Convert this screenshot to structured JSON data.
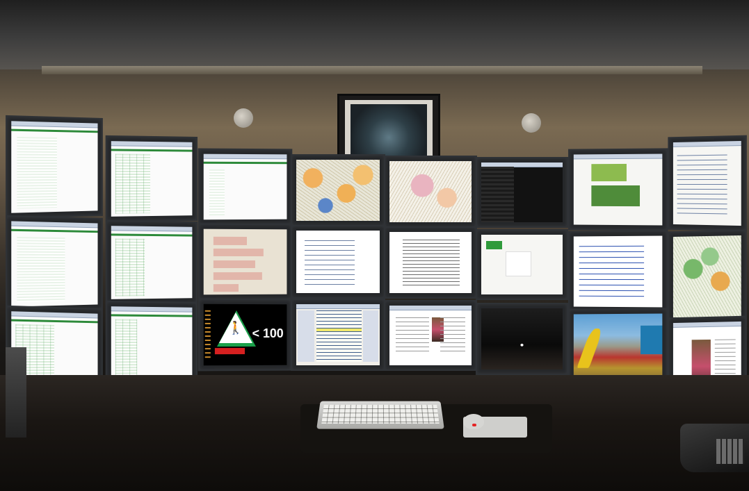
{
  "scene": {
    "description_free": true
  },
  "monitors": [
    {
      "row": 1,
      "col": 1,
      "content": "spreadsheet"
    },
    {
      "row": 1,
      "col": 2,
      "content": "spreadsheet"
    },
    {
      "row": 1,
      "col": 3,
      "content": "spreadsheet"
    },
    {
      "row": 1,
      "col": 4,
      "content": "map"
    },
    {
      "row": 1,
      "col": 5,
      "content": "map"
    },
    {
      "row": 1,
      "col": 6,
      "content": "dark-terminal"
    },
    {
      "row": 1,
      "col": 7,
      "content": "web-page"
    },
    {
      "row": 1,
      "col": 8,
      "content": "web-page"
    },
    {
      "row": 2,
      "col": 1,
      "content": "spreadsheet"
    },
    {
      "row": 2,
      "col": 2,
      "content": "spreadsheet"
    },
    {
      "row": 2,
      "col": 3,
      "content": "forum"
    },
    {
      "row": 2,
      "col": 4,
      "content": "document"
    },
    {
      "row": 2,
      "col": 5,
      "content": "wiki-page"
    },
    {
      "row": 2,
      "col": 6,
      "content": "web-page"
    },
    {
      "row": 2,
      "col": 7,
      "content": "search-results"
    },
    {
      "row": 2,
      "col": 8,
      "content": "map"
    },
    {
      "row": 3,
      "col": 1,
      "content": "spreadsheet"
    },
    {
      "row": 3,
      "col": 2,
      "content": "spreadsheet"
    },
    {
      "row": 3,
      "col": 3,
      "content": "traffic-sign"
    },
    {
      "row": 3,
      "col": 4,
      "content": "code-editor"
    },
    {
      "row": 3,
      "col": 5,
      "content": "blog"
    },
    {
      "row": 3,
      "col": 6,
      "content": "night-photo"
    },
    {
      "row": 3,
      "col": 7,
      "content": "race-photo"
    },
    {
      "row": 3,
      "col": 8,
      "content": "blog"
    }
  ],
  "sign": {
    "text": "< 100"
  }
}
